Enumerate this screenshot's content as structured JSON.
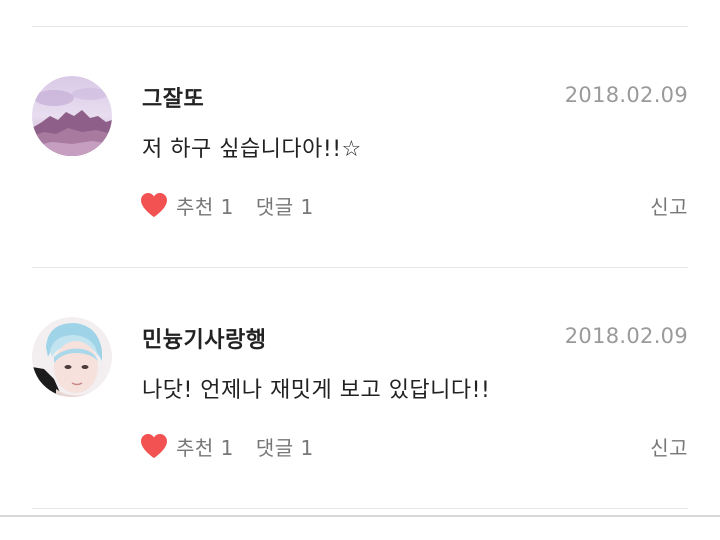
{
  "comments": [
    {
      "username": "그잘또",
      "date": "2018.02.09",
      "text": "저 하구 싶습니다아!!☆",
      "like_label": "추천 1",
      "reply_label": "댓글 1",
      "report_label": "신고",
      "avatar_icon": "mountain-landscape-avatar"
    },
    {
      "username": "민늉기사랑행",
      "date": "2018.02.09",
      "text": "나닷! 언제나 재밋게 보고 있답니다!!",
      "like_label": "추천 1",
      "reply_label": "댓글 1",
      "report_label": "신고",
      "avatar_icon": "person-portrait-avatar"
    }
  ],
  "colors": {
    "heart": "#f25252",
    "date": "#9a9a9a",
    "action_text": "#777777",
    "divider": "#e6e6e6"
  }
}
